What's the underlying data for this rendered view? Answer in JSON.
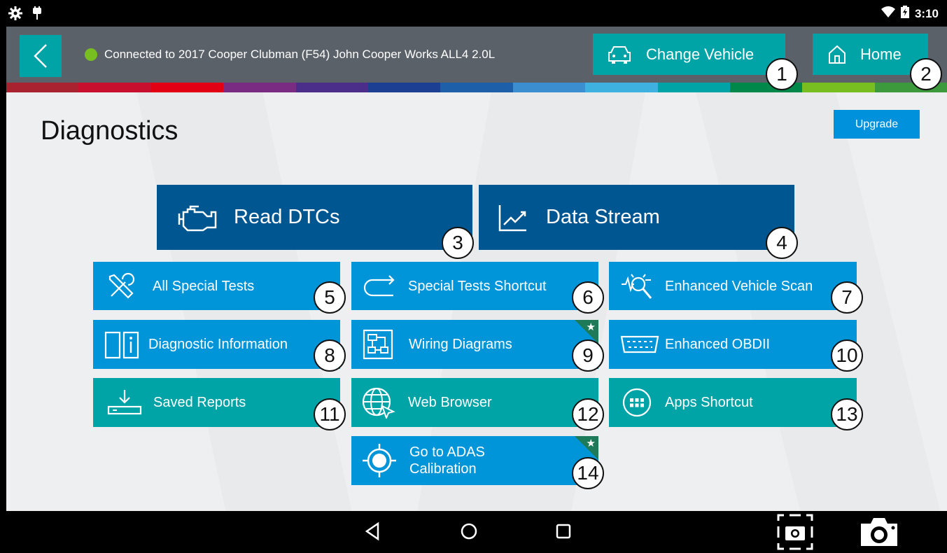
{
  "status_bar": {
    "time": "3:10",
    "left_icons": [
      "settings-icon",
      "debug-icon"
    ],
    "right_icons": [
      "wifi-icon",
      "battery-icon"
    ]
  },
  "header": {
    "connection_status": "Connected to 2017 Cooper Clubman (F54) John Cooper Works ALL4 2.0L",
    "connection_color": "#78be20",
    "change_vehicle_label": "Change Vehicle",
    "home_label": "Home"
  },
  "page": {
    "title": "Diagnostics",
    "upgrade_label": "Upgrade"
  },
  "tiles": {
    "read_dtcs": "Read DTCs",
    "data_stream": "Data Stream",
    "all_special_tests": "All Special Tests",
    "special_tests_shortcut": "Special Tests Shortcut",
    "enhanced_vehicle_scan": "Enhanced Vehicle Scan",
    "diagnostic_information": "Diagnostic Information",
    "wiring_diagrams": "Wiring Diagrams",
    "enhanced_obdii": "Enhanced OBDII",
    "saved_reports": "Saved Reports",
    "web_browser": "Web Browser",
    "apps_shortcut": "Apps Shortcut",
    "adas_line1": "Go to ADAS",
    "adas_line2": "Calibration"
  },
  "callouts": {
    "c1": "1",
    "c2": "2",
    "c3": "3",
    "c4": "4",
    "c5": "5",
    "c6": "6",
    "c7": "7",
    "c8": "8",
    "c9": "9",
    "c10": "10",
    "c11": "11",
    "c12": "12",
    "c13": "13",
    "c14": "14"
  },
  "colors": {
    "dark_blue": "#005691",
    "light_blue": "#0095d8",
    "teal": "#00a4a7",
    "header_gray": "#5b6169",
    "favorite_green": "#1e7b5a",
    "brand_strip": [
      "#a8232f",
      "#c8102e",
      "#e20015",
      "#7a2c82",
      "#4a2e8a",
      "#1c3f94",
      "#1d5fa8",
      "#3b8fd0",
      "#3fb1e0",
      "#00a4a7",
      "#00884a",
      "#78be20",
      "#3c9a3c"
    ]
  },
  "navigation": {
    "items": [
      "back-triangle-icon",
      "home-circle-icon",
      "recents-square-icon",
      "screenshot-icon",
      "camera-icon"
    ]
  }
}
